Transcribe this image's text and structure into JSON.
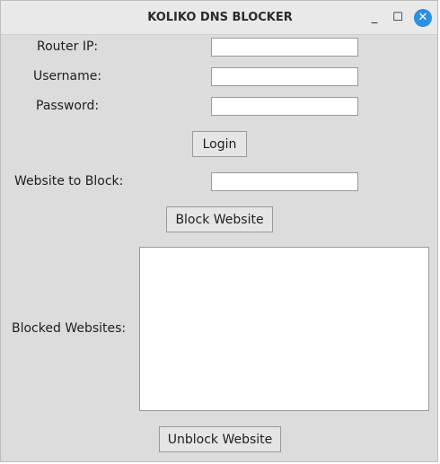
{
  "window": {
    "title": "KOLIKO DNS BLOCKER",
    "minimize_glyph": "_",
    "maximize_glyph": "☐",
    "close_glyph": "✕"
  },
  "form": {
    "router_ip_label": "Router IP:",
    "router_ip_value": "",
    "username_label": "Username:",
    "username_value": "",
    "password_label": "Password:",
    "password_value": "",
    "login_button": "Login",
    "website_label": "Website to Block:",
    "website_value": "",
    "block_button": "Block Website"
  },
  "blocked": {
    "label": "Blocked Websites:",
    "items": [],
    "unblock_button": "Unblock Website"
  },
  "colors": {
    "window_bg": "#dcdcdc",
    "titlebar_bg": "#e9e9e9",
    "close_button": "#2d8fe0",
    "entry_bg": "#ffffff"
  }
}
